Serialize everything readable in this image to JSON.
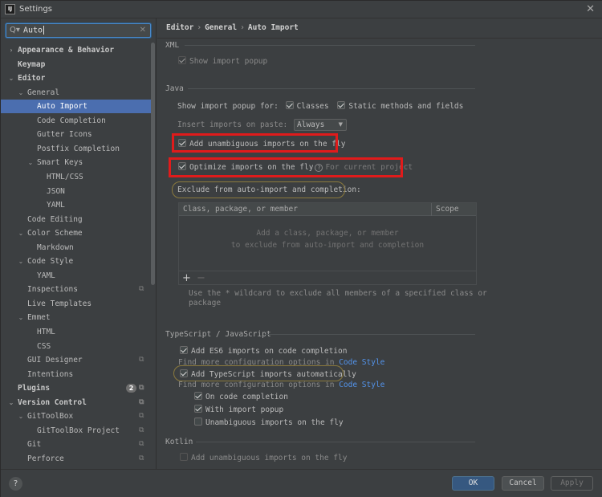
{
  "window": {
    "title": "Settings",
    "app_icon": "IJ"
  },
  "search": {
    "value": "Auto",
    "search_icon": "Q▾",
    "clear_icon": "✕"
  },
  "sidebar": {
    "items": [
      {
        "label": "Appearance & Behavior",
        "bold": true,
        "arrow": "›"
      },
      {
        "label": "Keymap",
        "bold": true
      },
      {
        "label": "Editor",
        "bold": true,
        "arrow": "⌄"
      },
      {
        "label": "General",
        "arrow": "⌄"
      },
      {
        "label": "Auto Import",
        "selected": true
      },
      {
        "label": "Code Completion"
      },
      {
        "label": "Gutter Icons"
      },
      {
        "label": "Postfix Completion"
      },
      {
        "label": "Smart Keys",
        "arrow": "⌄"
      },
      {
        "label": "HTML/CSS"
      },
      {
        "label": "JSON"
      },
      {
        "label": "YAML"
      },
      {
        "label": "Code Editing"
      },
      {
        "label": "Color Scheme",
        "arrow": "⌄"
      },
      {
        "label": "Markdown"
      },
      {
        "label": "Code Style",
        "arrow": "⌄"
      },
      {
        "label": "YAML"
      },
      {
        "label": "Inspections"
      },
      {
        "label": "Live Templates"
      },
      {
        "label": "Emmet",
        "arrow": "⌄"
      },
      {
        "label": "HTML"
      },
      {
        "label": "CSS"
      },
      {
        "label": "GUI Designer"
      },
      {
        "label": "Intentions"
      },
      {
        "label": "Plugins",
        "bold": true,
        "badge": "2"
      },
      {
        "label": "Version Control",
        "bold": true,
        "arrow": "⌄"
      },
      {
        "label": "GitToolBox",
        "arrow": "⌄"
      },
      {
        "label": "GitToolBox Project"
      },
      {
        "label": "Git"
      },
      {
        "label": "Perforce"
      }
    ]
  },
  "breadcrumb": {
    "parts": [
      "Editor",
      "General",
      "Auto Import"
    ],
    "separator": "›"
  },
  "xml": {
    "title": "XML",
    "show_import_popup": "Show import popup"
  },
  "java": {
    "title": "Java",
    "show_popup_for": "Show import popup for:",
    "classes": "Classes",
    "static_methods": "Static methods and fields",
    "insert_on_paste": "Insert imports on paste:",
    "insert_value": "Always",
    "add_unambiguous": "Add unambiguous imports on the fly",
    "optimize": "Optimize imports on the fly",
    "for_current_project": "For current project",
    "exclude_label": "Exclude from auto-import and completion:",
    "table_col1": "Class, package, or member",
    "table_col2": "Scope",
    "empty_line1": "Add a class, package, or member",
    "empty_line2": "to exclude from auto-import and completion",
    "add": "+",
    "remove": "−",
    "wildcard_hint_line1": "Use the * wildcard to exclude all members of a specified class or",
    "wildcard_hint_line2": "package"
  },
  "ts": {
    "title": "TypeScript / JavaScript",
    "add_es6": "Add ES6 imports on code completion",
    "find_more_1": "Find more configuration options in ",
    "code_style_link_1": "Code Style",
    "add_ts": "Add TypeScript imports automatically",
    "find_more_2": "Find more configuration options in ",
    "code_style_link_2": "Code Style",
    "on_completion": "On code completion",
    "with_popup": "With import popup",
    "unambiguous": "Unambiguous imports on the fly"
  },
  "kotlin": {
    "title": "Kotlin",
    "add_unambiguous": "Add unambiguous imports on the fly"
  },
  "footer": {
    "help": "?",
    "ok": "OK",
    "cancel": "Cancel",
    "apply": "Apply"
  },
  "colors": {
    "accent": "#4b6eaf",
    "highlight_red": "#e01b1b",
    "highlight_oval": "#8b7a3d",
    "link": "#5394ec"
  }
}
